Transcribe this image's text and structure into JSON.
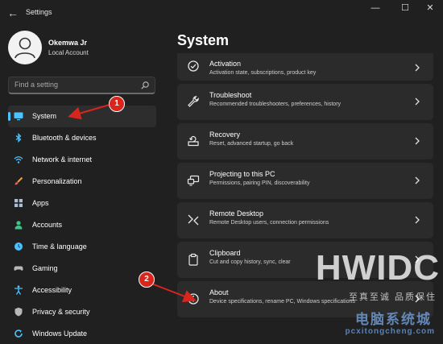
{
  "window": {
    "title": "Settings",
    "controls": {
      "minimize": "—",
      "maximize": "☐",
      "close": "✕"
    }
  },
  "profile": {
    "name": "Okemwa Jr",
    "account": "Local Account"
  },
  "search": {
    "placeholder": "Find a setting"
  },
  "sidebar": {
    "items": [
      {
        "label": "System",
        "icon": "monitor-icon",
        "color": "#4cc2ff",
        "selected": true
      },
      {
        "label": "Bluetooth & devices",
        "icon": "bluetooth-icon",
        "color": "#4cc2ff"
      },
      {
        "label": "Network & internet",
        "icon": "wifi-icon",
        "color": "#4cc2ff"
      },
      {
        "label": "Personalization",
        "icon": "brush-icon",
        "color": "#e8a24a"
      },
      {
        "label": "Apps",
        "icon": "apps-icon",
        "color": "#a9bfd6"
      },
      {
        "label": "Accounts",
        "icon": "person-icon",
        "color": "#3fc48b"
      },
      {
        "label": "Time & language",
        "icon": "globe-clock-icon",
        "color": "#4cc2ff"
      },
      {
        "label": "Gaming",
        "icon": "gamepad-icon",
        "color": "#b8b8b8"
      },
      {
        "label": "Accessibility",
        "icon": "accessibility-icon",
        "color": "#4cc2ff"
      },
      {
        "label": "Privacy & security",
        "icon": "shield-icon",
        "color": "#b8b8b8"
      },
      {
        "label": "Windows Update",
        "icon": "update-icon",
        "color": "#4cc2ff"
      }
    ]
  },
  "main": {
    "title": "System",
    "items": [
      {
        "title": "Activation",
        "subtitle": "Activation state, subscriptions, product key",
        "icon": "check-circle-icon"
      },
      {
        "title": "Troubleshoot",
        "subtitle": "Recommended troubleshooters, preferences, history",
        "icon": "wrench-icon"
      },
      {
        "title": "Recovery",
        "subtitle": "Reset, advanced startup, go back",
        "icon": "recovery-icon"
      },
      {
        "title": "Projecting to this PC",
        "subtitle": "Permissions, pairing PIN, discoverability",
        "icon": "project-icon"
      },
      {
        "title": "Remote Desktop",
        "subtitle": "Remote Desktop users, connection permissions",
        "icon": "remote-desktop-icon"
      },
      {
        "title": "Clipboard",
        "subtitle": "Cut and copy history, sync, clear",
        "icon": "clipboard-icon"
      },
      {
        "title": "About",
        "subtitle": "Device specifications, rename PC, Windows specifications",
        "icon": "info-icon"
      }
    ]
  },
  "annotations": {
    "badge1": "1",
    "badge2": "2",
    "color": "#d9261c"
  },
  "watermark": {
    "text": "HWIDC",
    "sub": "至真至诚 品质保住",
    "brand": "电脑系统城",
    "url": "pcxitongcheng.com"
  }
}
